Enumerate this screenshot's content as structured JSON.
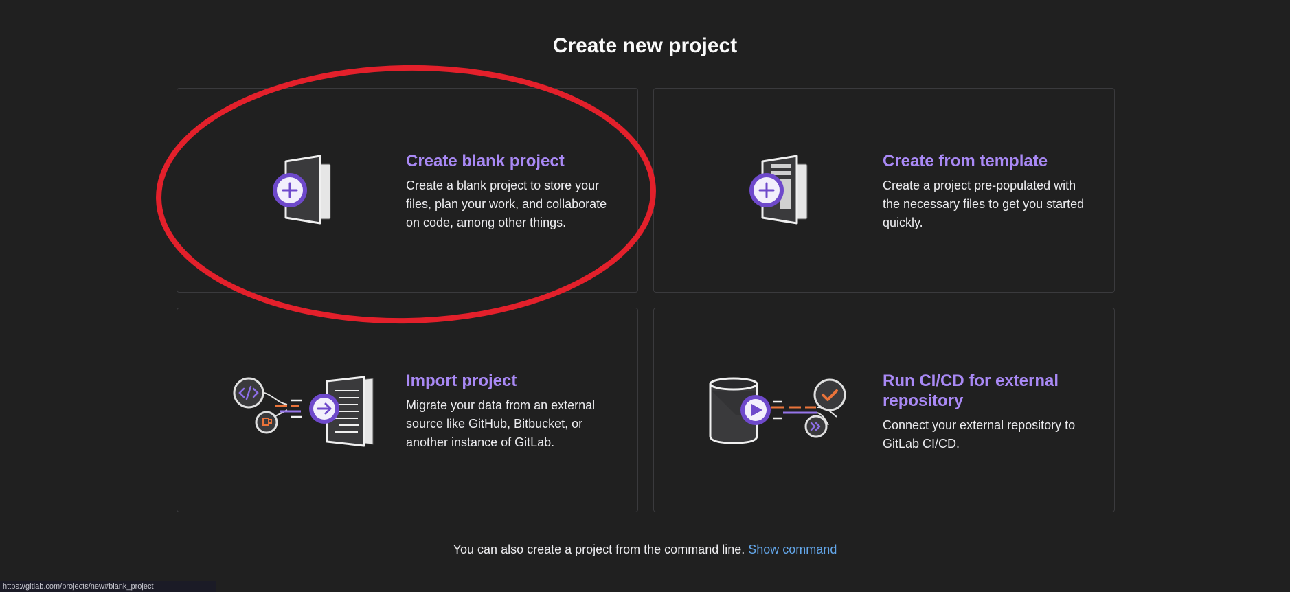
{
  "page": {
    "title": "Create new project"
  },
  "cards": [
    {
      "title": "Create blank project",
      "description": "Create a blank project to store your files, plan your work, and collaborate on code, among other things.",
      "icon": "blank-project-icon"
    },
    {
      "title": "Create from template",
      "description": "Create a project pre-populated with the necessary files to get you started quickly.",
      "icon": "template-project-icon"
    },
    {
      "title": "Import project",
      "description": "Migrate your data from an external source like GitHub, Bitbucket, or another instance of GitLab.",
      "icon": "import-project-icon"
    },
    {
      "title": "Run CI/CD for external repository",
      "description": "Connect your external repository to GitLab CI/CD.",
      "icon": "ci-cd-project-icon"
    }
  ],
  "footer": {
    "text": "You can also create a project from the command line.",
    "link_label": "Show command"
  },
  "status_bar": {
    "url": "https://gitlab.com/projects/new#blank_project"
  },
  "colors": {
    "background": "#202020",
    "accent_purple": "#a989f5",
    "link_blue": "#63a6e9",
    "annotation_red": "#e3202b",
    "card_border": "#3a3a3d",
    "icon_orange": "#e9733a"
  }
}
